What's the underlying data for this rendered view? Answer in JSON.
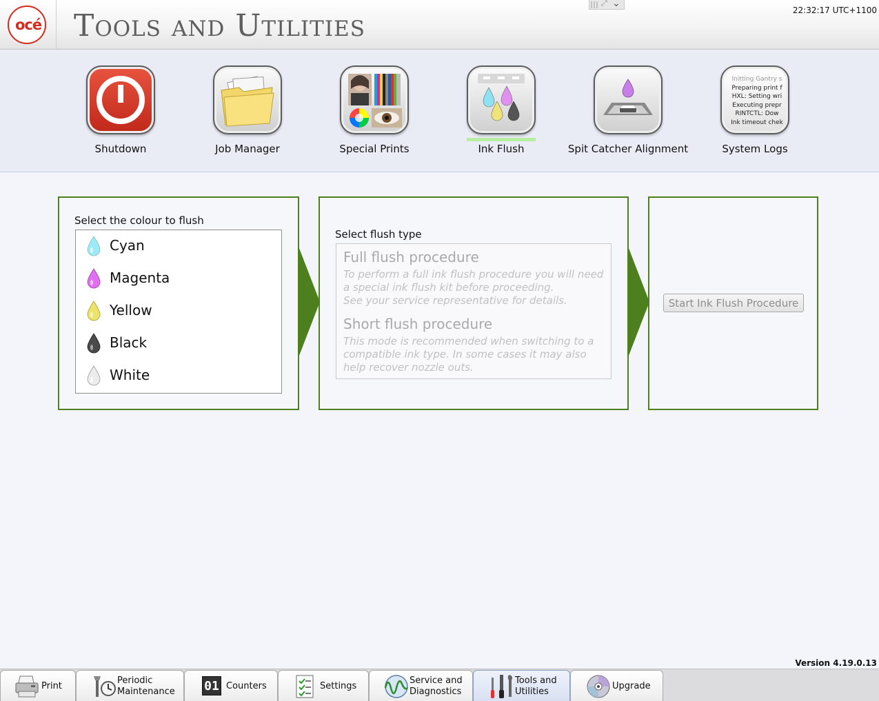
{
  "header": {
    "logo_text": "océ",
    "title": "Tools and Utilities",
    "clock": "22:32:17 UTC+1100"
  },
  "tools": [
    {
      "label": "Shutdown",
      "icon": "power-icon"
    },
    {
      "label": "Job Manager",
      "icon": "folder-icon"
    },
    {
      "label": "Special Prints",
      "icon": "special-prints-icon"
    },
    {
      "label": "Ink Flush",
      "icon": "ink-drops-icon",
      "active": true
    },
    {
      "label": "Spit Catcher Alignment",
      "icon": "spit-catcher-icon"
    },
    {
      "label": "System Logs",
      "icon": "log-text-icon",
      "log_lines": [
        "Initting Gantry s",
        "Preparing print f",
        "HXL: Setting wri",
        "Executing prepr",
        "RINTCTL: Dow",
        "Ink timeout chek"
      ]
    }
  ],
  "colour_panel": {
    "label": "Select the colour to flush",
    "colours": [
      {
        "name": "Cyan",
        "color": "#6fd8ee"
      },
      {
        "name": "Magenta",
        "color": "#d24fe0"
      },
      {
        "name": "Yellow",
        "color": "#e6dd3a"
      },
      {
        "name": "Black",
        "color": "#444444"
      },
      {
        "name": "White",
        "color": "#e2e2e2"
      }
    ]
  },
  "flush_panel": {
    "label": "Select flush type",
    "full": {
      "title": "Full flush procedure",
      "desc": "To perform a full ink flush procedure you will need a special ink flush kit before proceeding.",
      "desc2": "See your service representative for details."
    },
    "short": {
      "title": "Short flush procedure",
      "desc": "This mode is recommended when switching to a compatible ink type. In some cases it may also help recover nozzle outs."
    }
  },
  "start_panel": {
    "button": "Start Ink Flush Procedure"
  },
  "version": "Version 4.19.0.13",
  "tabs": [
    {
      "label1": "Print",
      "label2": "",
      "icon": "printer-icon"
    },
    {
      "label1": "Periodic",
      "label2": "Maintenance",
      "icon": "maintenance-clock-icon"
    },
    {
      "label1": "Counters",
      "label2": "",
      "icon": "counter-icon",
      "counter_text": "01"
    },
    {
      "label1": "Settings",
      "label2": "",
      "icon": "checklist-icon"
    },
    {
      "label1": "Service and",
      "label2": "Diagnostics",
      "icon": "waveform-icon"
    },
    {
      "label1": "Tools and",
      "label2": "Utilities",
      "icon": "tools-icon",
      "active": true
    },
    {
      "label1": "Upgrade",
      "label2": "",
      "icon": "disc-icon"
    }
  ],
  "colors": {
    "panel_border": "#4d7f1e",
    "arrow": "#4d7f1e",
    "active_bar": "#b7eea2",
    "brand_red": "#d32b1e"
  }
}
